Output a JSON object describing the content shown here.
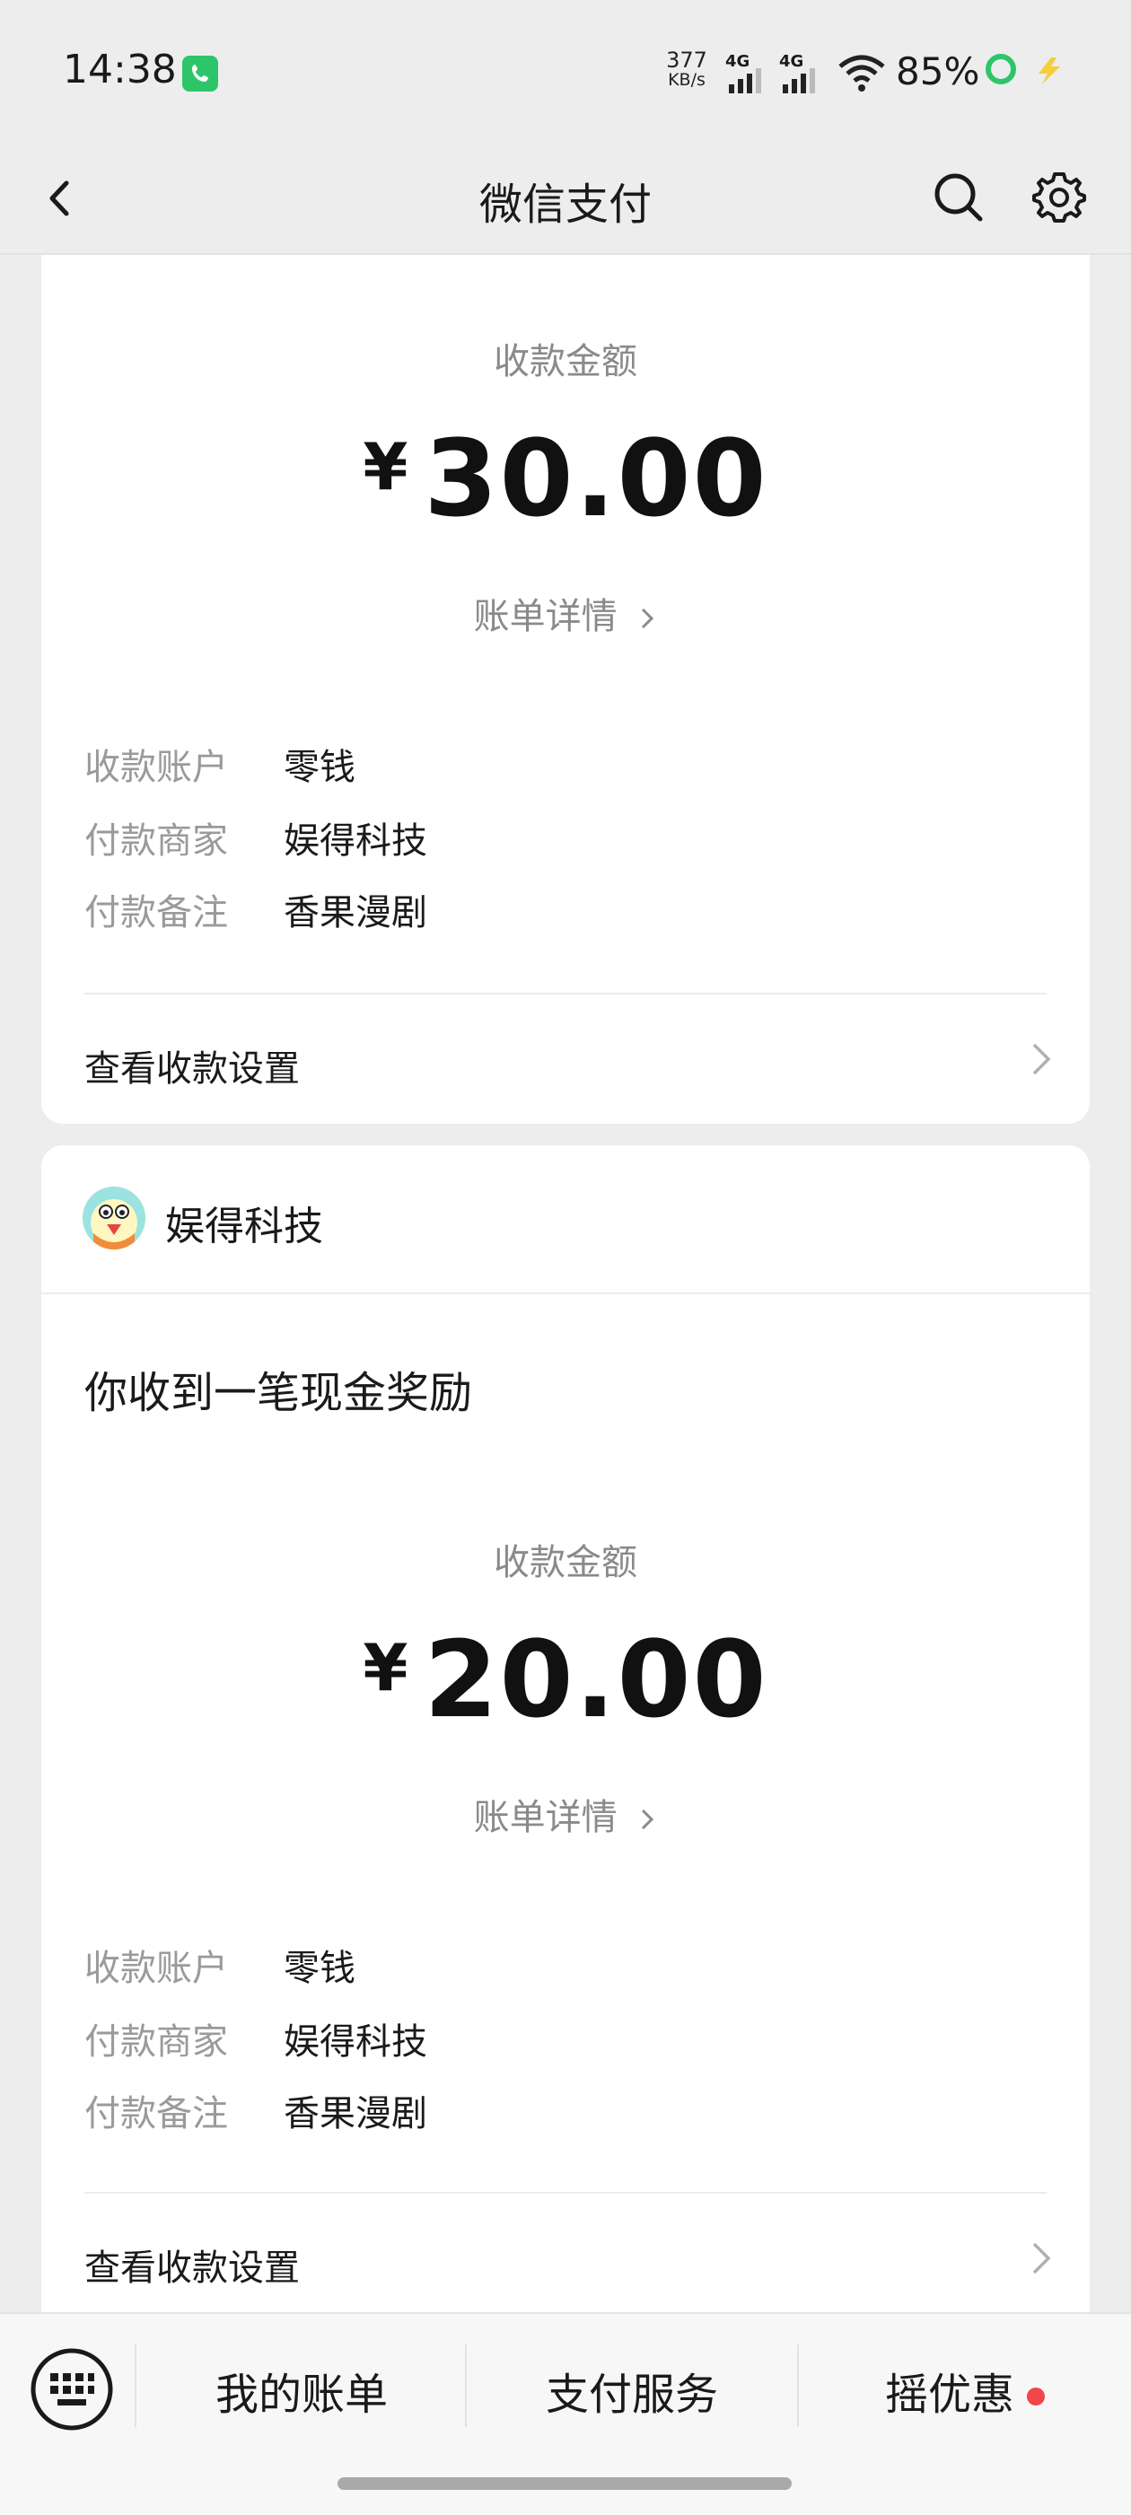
{
  "status_bar": {
    "time": "14:38",
    "net_speed_value": "377",
    "net_speed_unit": "KB/s",
    "sim1_label": "4G",
    "sim2_label": "4G",
    "battery": "85%",
    "accent_color": "#2ec56a"
  },
  "nav": {
    "title": "微信支付"
  },
  "cards": [
    {
      "amount_label": "收款金额",
      "currency": "¥",
      "amount": "30.00",
      "bill_detail": "账单详情",
      "rows": [
        {
          "key": "收款账户",
          "value": "零钱"
        },
        {
          "key": "付款商家",
          "value": "娱得科技"
        },
        {
          "key": "付款备注",
          "value": "香果漫剧"
        }
      ],
      "settings_link": "查看收款设置"
    },
    {
      "merchant": "娱得科技",
      "message": "你收到一笔现金奖励",
      "amount_label": "收款金额",
      "currency": "¥",
      "amount": "20.00",
      "bill_detail": "账单详情",
      "rows": [
        {
          "key": "收款账户",
          "value": "零钱"
        },
        {
          "key": "付款商家",
          "value": "娱得科技"
        },
        {
          "key": "付款备注",
          "value": "香果漫剧"
        }
      ],
      "settings_link": "查看收款设置"
    }
  ],
  "tabbar": {
    "tabs": [
      {
        "label": "我的账单"
      },
      {
        "label": "支付服务"
      },
      {
        "label": "摇优惠",
        "has_badge": true
      }
    ],
    "badge_color": "#f0474a"
  }
}
